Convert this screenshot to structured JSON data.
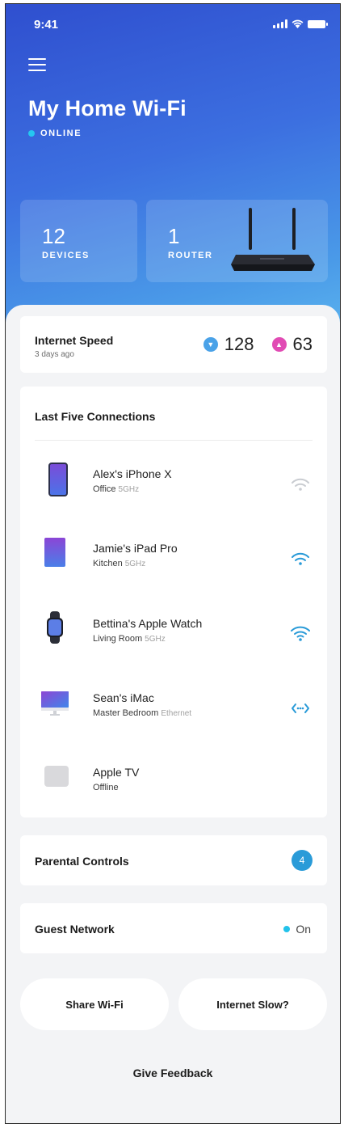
{
  "status_bar": {
    "time": "9:41",
    "icons": [
      "signal-icon",
      "wifi-icon",
      "battery-icon"
    ]
  },
  "header": {
    "menu_icon": "hamburger-menu-icon",
    "title": "My Home Wi-Fi",
    "status": "ONLINE",
    "status_color": "#25c7f0"
  },
  "stats": {
    "devices": {
      "count": "12",
      "label": "DEVICES"
    },
    "router": {
      "count": "1",
      "label": "ROUTER",
      "image": "router-icon"
    }
  },
  "internet_speed": {
    "title": "Internet Speed",
    "subtitle": "3 days ago",
    "download": "128",
    "upload": "63",
    "download_color": "#4aa2e8",
    "upload_color": "#e14bb4"
  },
  "connections": {
    "title": "Last Five Connections",
    "items": [
      {
        "name": "Alex's iPhone X",
        "location": "Office",
        "band": "5GHz",
        "device_icon": "iphone-icon",
        "status_icon": "wifi-weak-icon"
      },
      {
        "name": "Jamie's iPad Pro",
        "location": "Kitchen",
        "band": "5GHz",
        "device_icon": "ipad-icon",
        "status_icon": "wifi-icon"
      },
      {
        "name": "Bettina's Apple Watch",
        "location": "Living Room",
        "band": "5GHz",
        "device_icon": "apple-watch-icon",
        "status_icon": "wifi-icon"
      },
      {
        "name": "Sean's iMac",
        "location": "Master Bedroom",
        "band": "Ethernet",
        "device_icon": "imac-icon",
        "status_icon": "ethernet-icon"
      },
      {
        "name": "Apple TV",
        "location": "Offline",
        "band": "",
        "device_icon": "apple-tv-icon",
        "status_icon": ""
      }
    ]
  },
  "parental_controls": {
    "label": "Parental Controls",
    "count": "4"
  },
  "guest_network": {
    "label": "Guest Network",
    "status": "On"
  },
  "actions": {
    "share": "Share Wi-Fi",
    "slow": "Internet Slow?",
    "feedback": "Give Feedback"
  },
  "colors": {
    "accent": "#2a9bd8",
    "hero_top": "#2f4fcf",
    "hero_bottom": "#5cb6ef"
  }
}
